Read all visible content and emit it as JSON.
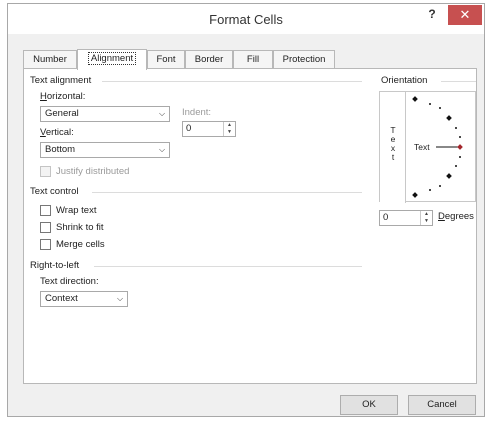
{
  "window": {
    "title": "Format Cells",
    "help": "?",
    "close": "✕"
  },
  "tabs": [
    {
      "label": "Number"
    },
    {
      "label": "Alignment"
    },
    {
      "label": "Font"
    },
    {
      "label": "Border"
    },
    {
      "label": "Fill"
    },
    {
      "label": "Protection"
    }
  ],
  "text_alignment": {
    "title": "Text alignment",
    "horizontal_label": "Horizontal:",
    "horizontal_value": "General",
    "indent_label": "Indent:",
    "indent_value": "0",
    "vertical_label": "Vertical:",
    "vertical_value": "Bottom",
    "justify_label": "Justify distributed"
  },
  "text_control": {
    "title": "Text control",
    "wrap": "Wrap text",
    "shrink": "Shrink to fit",
    "merge": "Merge cells"
  },
  "rtl": {
    "title": "Right-to-left",
    "direction_label": "Text direction:",
    "direction_value": "Context"
  },
  "orientation": {
    "title": "Orientation",
    "vertical_letters": [
      "T",
      "e",
      "x",
      "t"
    ],
    "dial_label": "Text",
    "degrees_value": "0",
    "degrees_label": "Degrees"
  },
  "buttons": {
    "ok": "OK",
    "cancel": "Cancel"
  },
  "colors": {
    "close": "#c75050",
    "dial_marker": "#a4262c",
    "dialog_bg": "#f0f0f0"
  }
}
